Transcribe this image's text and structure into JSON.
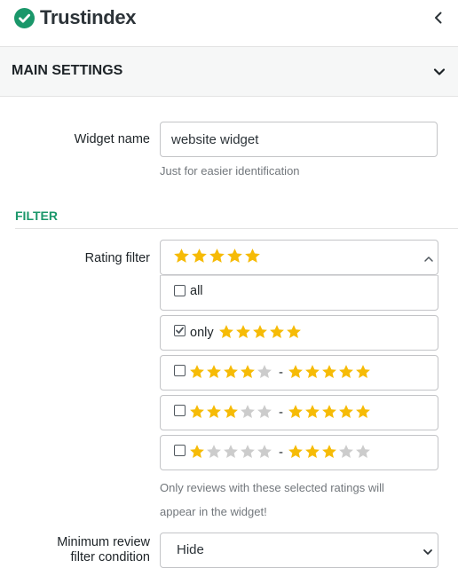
{
  "header": {
    "brand": "Trustindex",
    "collapse_icon": "chevron-left-icon"
  },
  "main_settings": {
    "title": "MAIN SETTINGS",
    "toggle_icon": "chevron-down-icon"
  },
  "widget_name": {
    "label": "Widget name",
    "value": "website widget",
    "hint": "Just for easier identification"
  },
  "filter": {
    "title": "FILTER",
    "rating_label": "Rating filter",
    "selected_stars": 5,
    "options": [
      {
        "label": "all",
        "checked": false
      },
      {
        "label": "only",
        "checked": true,
        "stars": 5
      },
      {
        "checked": false,
        "from": 4,
        "to": 5,
        "dash": "-"
      },
      {
        "checked": false,
        "from": 3,
        "to": 5,
        "dash": "-"
      },
      {
        "checked": false,
        "from": 1,
        "to": 3,
        "dash": "-"
      }
    ],
    "hint_line1": "Only reviews with these selected ratings will",
    "hint_line2": "appear in the widget!"
  },
  "min_review": {
    "label_line1": "Minimum review",
    "label_line2": "filter condition",
    "value": "Hide"
  },
  "colors": {
    "star_on": "#f6bb06",
    "star_off": "#cccccc",
    "accent": "#1a976a"
  }
}
